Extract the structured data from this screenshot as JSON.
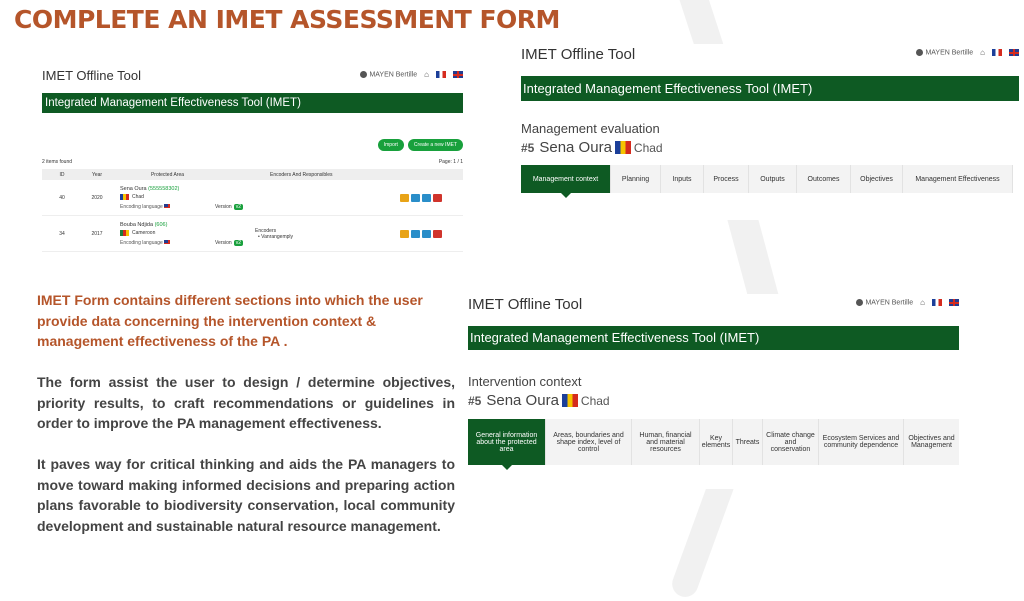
{
  "slide": {
    "title": "COMPLETE AN IMET ASSESSMENT FORM"
  },
  "colors": {
    "title": "#b5552a",
    "green_bar": "#0e5a23",
    "button_green": "#18a03c"
  },
  "app_common": {
    "title": "IMET Offline Tool",
    "user": "MAYEN Bertille",
    "banner": "Integrated Management Effectiveness Tool (IMET)"
  },
  "panel_list": {
    "buttons": {
      "import": "Import",
      "create": "Create a new IMET"
    },
    "items_found": "2 items found",
    "page": "Page: 1 / 1",
    "columns": {
      "id": "ID",
      "year": "Year",
      "pa": "Protected Area",
      "encoders": "Encoders And Responsibles"
    },
    "rows": [
      {
        "id": "40",
        "year": "2020",
        "pa_name": "Sena Oura",
        "wdpa": "(555558302)",
        "country": "Chad",
        "lang": "Encoding language",
        "version_label": "Version",
        "version": "v2",
        "encoders_title": "",
        "encoders_name": ""
      },
      {
        "id": "34",
        "year": "2017",
        "pa_name": "Bouba Ndjida",
        "wdpa": "(606)",
        "country": "Cameroon",
        "lang": "Encoding language",
        "version_label": "Version",
        "version": "v2",
        "encoders_title": "Encoders",
        "encoders_name": "• Vanrangemply"
      }
    ]
  },
  "panel_eval": {
    "section": "Management evaluation",
    "pa_num": "#5",
    "pa_name": "Sena Oura",
    "country": "Chad",
    "tabs": [
      "Management context",
      "Planning",
      "Inputs",
      "Process",
      "Outputs",
      "Outcomes",
      "Objectives",
      "Management Effectiveness"
    ],
    "active_tab": 0
  },
  "panel_context": {
    "section": "Intervention context",
    "pa_num": "#5",
    "pa_name": "Sena Oura",
    "country": "Chad",
    "tabs": [
      "General information about the protected area",
      "Areas, boundaries and shape index, level of control",
      "Human, financial and material resources",
      "Key elements",
      "Threats",
      "Climate change and conservation",
      "Ecosystem Services and community dependence",
      "Objectives and Management"
    ],
    "active_tab": 0
  },
  "text": {
    "p1": "IMET Form contains different sections into which the user provide data concerning the intervention context & management effectiveness of the PA .",
    "p2": "The form assist the user to design / determine objectives, priority results, to craft recommendations or guidelines in order to improve the PA  management effectiveness.",
    "p3": "It paves way for critical thinking and aids the PA managers to move toward making informed decisions and preparing action plans favorable to biodiversity conservation, local community development and sustainable natural resource management."
  }
}
